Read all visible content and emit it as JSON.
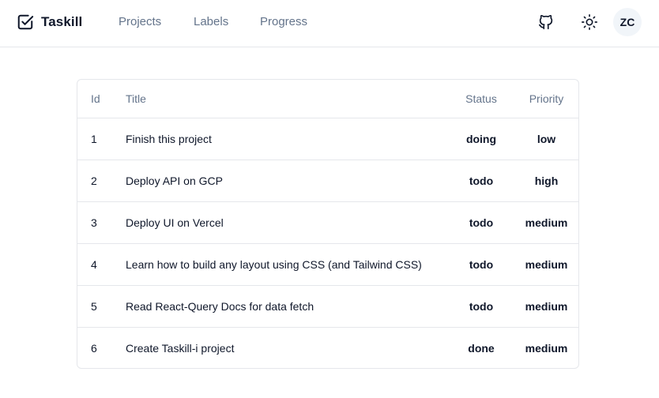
{
  "header": {
    "brand": "Taskill",
    "nav": [
      "Projects",
      "Labels",
      "Progress"
    ],
    "avatar_initials": "ZC"
  },
  "table": {
    "columns": [
      "Id",
      "Title",
      "Status",
      "Priority"
    ],
    "rows": [
      {
        "id": "1",
        "title": "Finish this project",
        "status": "doing",
        "priority": "low"
      },
      {
        "id": "2",
        "title": "Deploy API on GCP",
        "status": "todo",
        "priority": "high"
      },
      {
        "id": "3",
        "title": "Deploy UI on Vercel",
        "status": "todo",
        "priority": "medium"
      },
      {
        "id": "4",
        "title": "Learn how to build any layout using CSS (and Tailwind CSS)",
        "status": "todo",
        "priority": "medium"
      },
      {
        "id": "5",
        "title": "Read React-Query Docs for data fetch",
        "status": "todo",
        "priority": "medium"
      },
      {
        "id": "6",
        "title": "Create Taskill-i project",
        "status": "done",
        "priority": "medium"
      }
    ]
  }
}
